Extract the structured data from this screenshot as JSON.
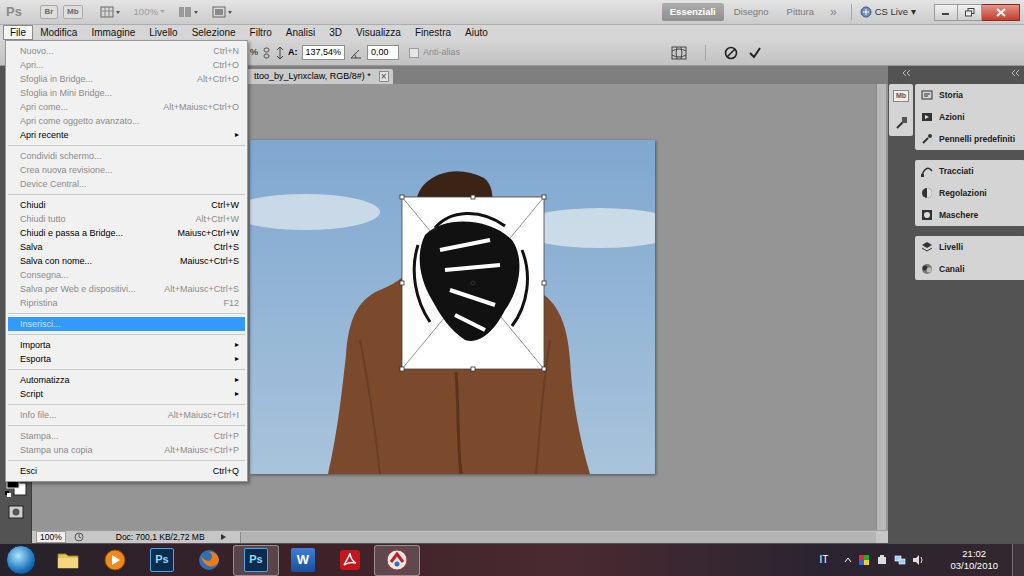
{
  "app": {
    "logo": "Ps",
    "bridge": "Br",
    "mini_bridge": "Mb",
    "zoom": {
      "label": "100%",
      "disabled": true
    }
  },
  "workspaces": [
    {
      "label": "Essenziali",
      "selected": true
    },
    {
      "label": "Disegno",
      "selected": false
    },
    {
      "label": "Pittura",
      "selected": false
    }
  ],
  "more_workspaces": "»",
  "cs_live": {
    "label": "CS Live",
    "arrow": "▾"
  },
  "menubar": [
    {
      "label": "File",
      "selected": true
    },
    {
      "label": "Modifica",
      "selected": false
    },
    {
      "label": "Immagine",
      "selected": false
    },
    {
      "label": "Livello",
      "selected": false
    },
    {
      "label": "Selezione",
      "selected": false
    },
    {
      "label": "Filtro",
      "selected": false
    },
    {
      "label": "Analisi",
      "selected": false
    },
    {
      "label": "3D",
      "selected": false
    },
    {
      "label": "Visualizza",
      "selected": false
    },
    {
      "label": "Finestra",
      "selected": false
    },
    {
      "label": "Aiuto",
      "selected": false
    }
  ],
  "file_menu": [
    {
      "kind": "item",
      "label": "Nuovo...",
      "shortcut": "Ctrl+N",
      "disabled": true,
      "highlighted": false
    },
    {
      "kind": "item",
      "label": "Apri...",
      "shortcut": "Ctrl+O",
      "disabled": true,
      "highlighted": false
    },
    {
      "kind": "item",
      "label": "Sfoglia in Bridge...",
      "shortcut": "Alt+Ctrl+O",
      "disabled": true,
      "highlighted": false
    },
    {
      "kind": "item",
      "label": "Sfoglia in Mini Bridge...",
      "disabled": true,
      "highlighted": false
    },
    {
      "kind": "item",
      "label": "Apri come...",
      "shortcut": "Alt+Maiusc+Ctrl+O",
      "disabled": true,
      "highlighted": false
    },
    {
      "kind": "item",
      "label": "Apri come oggetto avanzato...",
      "disabled": true,
      "highlighted": false
    },
    {
      "kind": "item",
      "label": "Apri recente",
      "submenu": "▸",
      "disabled": false,
      "highlighted": false
    },
    {
      "kind": "separator"
    },
    {
      "kind": "item",
      "label": "Condividi schermo...",
      "disabled": true,
      "highlighted": false
    },
    {
      "kind": "item",
      "label": "Crea nuova revisione...",
      "disabled": true,
      "highlighted": false
    },
    {
      "kind": "item",
      "label": "Device Central...",
      "disabled": true,
      "highlighted": false
    },
    {
      "kind": "separator"
    },
    {
      "kind": "item",
      "label": "Chiudi",
      "shortcut": "Ctrl+W",
      "disabled": false,
      "highlighted": false
    },
    {
      "kind": "item",
      "label": "Chiudi tutto",
      "shortcut": "Alt+Ctrl+W",
      "disabled": true,
      "highlighted": false
    },
    {
      "kind": "item",
      "label": "Chiudi e passa a Bridge...",
      "shortcut": "Maiusc+Ctrl+W",
      "disabled": false,
      "highlighted": false
    },
    {
      "kind": "item",
      "label": "Salva",
      "shortcut": "Ctrl+S",
      "disabled": false,
      "highlighted": false
    },
    {
      "kind": "item",
      "label": "Salva con nome...",
      "shortcut": "Maiusc+Ctrl+S",
      "disabled": false,
      "highlighted": false
    },
    {
      "kind": "item",
      "label": "Consegna...",
      "disabled": true,
      "highlighted": false
    },
    {
      "kind": "item",
      "label": "Salva per Web e dispositivi...",
      "shortcut": "Alt+Maiusc+Ctrl+S",
      "disabled": true,
      "highlighted": false
    },
    {
      "kind": "item",
      "label": "Ripristina",
      "shortcut": "F12",
      "disabled": true,
      "highlighted": false
    },
    {
      "kind": "separator"
    },
    {
      "kind": "item",
      "label": "Inserisci...",
      "disabled": true,
      "highlighted": true
    },
    {
      "kind": "separator"
    },
    {
      "kind": "item",
      "label": "Importa",
      "submenu": "▸",
      "disabled": false,
      "highlighted": false
    },
    {
      "kind": "item",
      "label": "Esporta",
      "submenu": "▸",
      "disabled": false,
      "highlighted": false
    },
    {
      "kind": "separator"
    },
    {
      "kind": "item",
      "label": "Automatizza",
      "submenu": "▸",
      "disabled": false,
      "highlighted": false
    },
    {
      "kind": "item",
      "label": "Script",
      "submenu": "▸",
      "disabled": false,
      "highlighted": false
    },
    {
      "kind": "separator"
    },
    {
      "kind": "item",
      "label": "Info file...",
      "shortcut": "Alt+Maiusc+Ctrl+I",
      "disabled": true,
      "highlighted": false
    },
    {
      "kind": "separator"
    },
    {
      "kind": "item",
      "label": "Stampa...",
      "shortcut": "Ctrl+P",
      "disabled": true,
      "highlighted": false
    },
    {
      "kind": "item",
      "label": "Stampa una copia",
      "shortcut": "Alt+Maiusc+Ctrl+P",
      "disabled": true,
      "highlighted": false
    },
    {
      "kind": "separator"
    },
    {
      "kind": "item",
      "label": "Esci",
      "shortcut": "Ctrl+Q",
      "disabled": false,
      "highlighted": false
    }
  ],
  "options_bar": {
    "width_value": "%",
    "height_label": "A:",
    "height_value": "137,54%",
    "angle_value": "0,00",
    "antialias": {
      "label": "Anti-alias",
      "checked": false,
      "disabled": true
    }
  },
  "document": {
    "tab": "ttoo_by_Lynxclaw, RGB/8#) *",
    "close": "×"
  },
  "status_bar": {
    "zoom": "100%",
    "doc": "Doc: 700,1 KB/2,72 MB"
  },
  "dock": {
    "strip_label": "Mb",
    "groups": [
      {
        "items": [
          {
            "label": "Storia"
          },
          {
            "label": "Azioni"
          },
          {
            "label": "Pennelli predefiniti"
          }
        ]
      },
      {
        "items": [
          {
            "label": "Tracciati"
          },
          {
            "label": "Regolazioni"
          },
          {
            "label": "Maschere"
          }
        ]
      },
      {
        "items": [
          {
            "label": "Livelli"
          },
          {
            "label": "Canali"
          }
        ]
      }
    ]
  },
  "taskbar": {
    "apps": [
      {
        "kind": "explorer",
        "active": false
      },
      {
        "kind": "media",
        "active": false
      },
      {
        "kind": "photoshop",
        "label": "Ps",
        "active": false
      },
      {
        "kind": "firefox",
        "active": false
      },
      {
        "kind": "photoshop",
        "label": "Ps",
        "active": true
      },
      {
        "kind": "word",
        "label": "W",
        "active": false
      },
      {
        "kind": "acrobat",
        "active": false
      },
      {
        "kind": "app",
        "active": true
      }
    ],
    "language": "IT",
    "time": "21:02",
    "date": "03/10/2010"
  }
}
